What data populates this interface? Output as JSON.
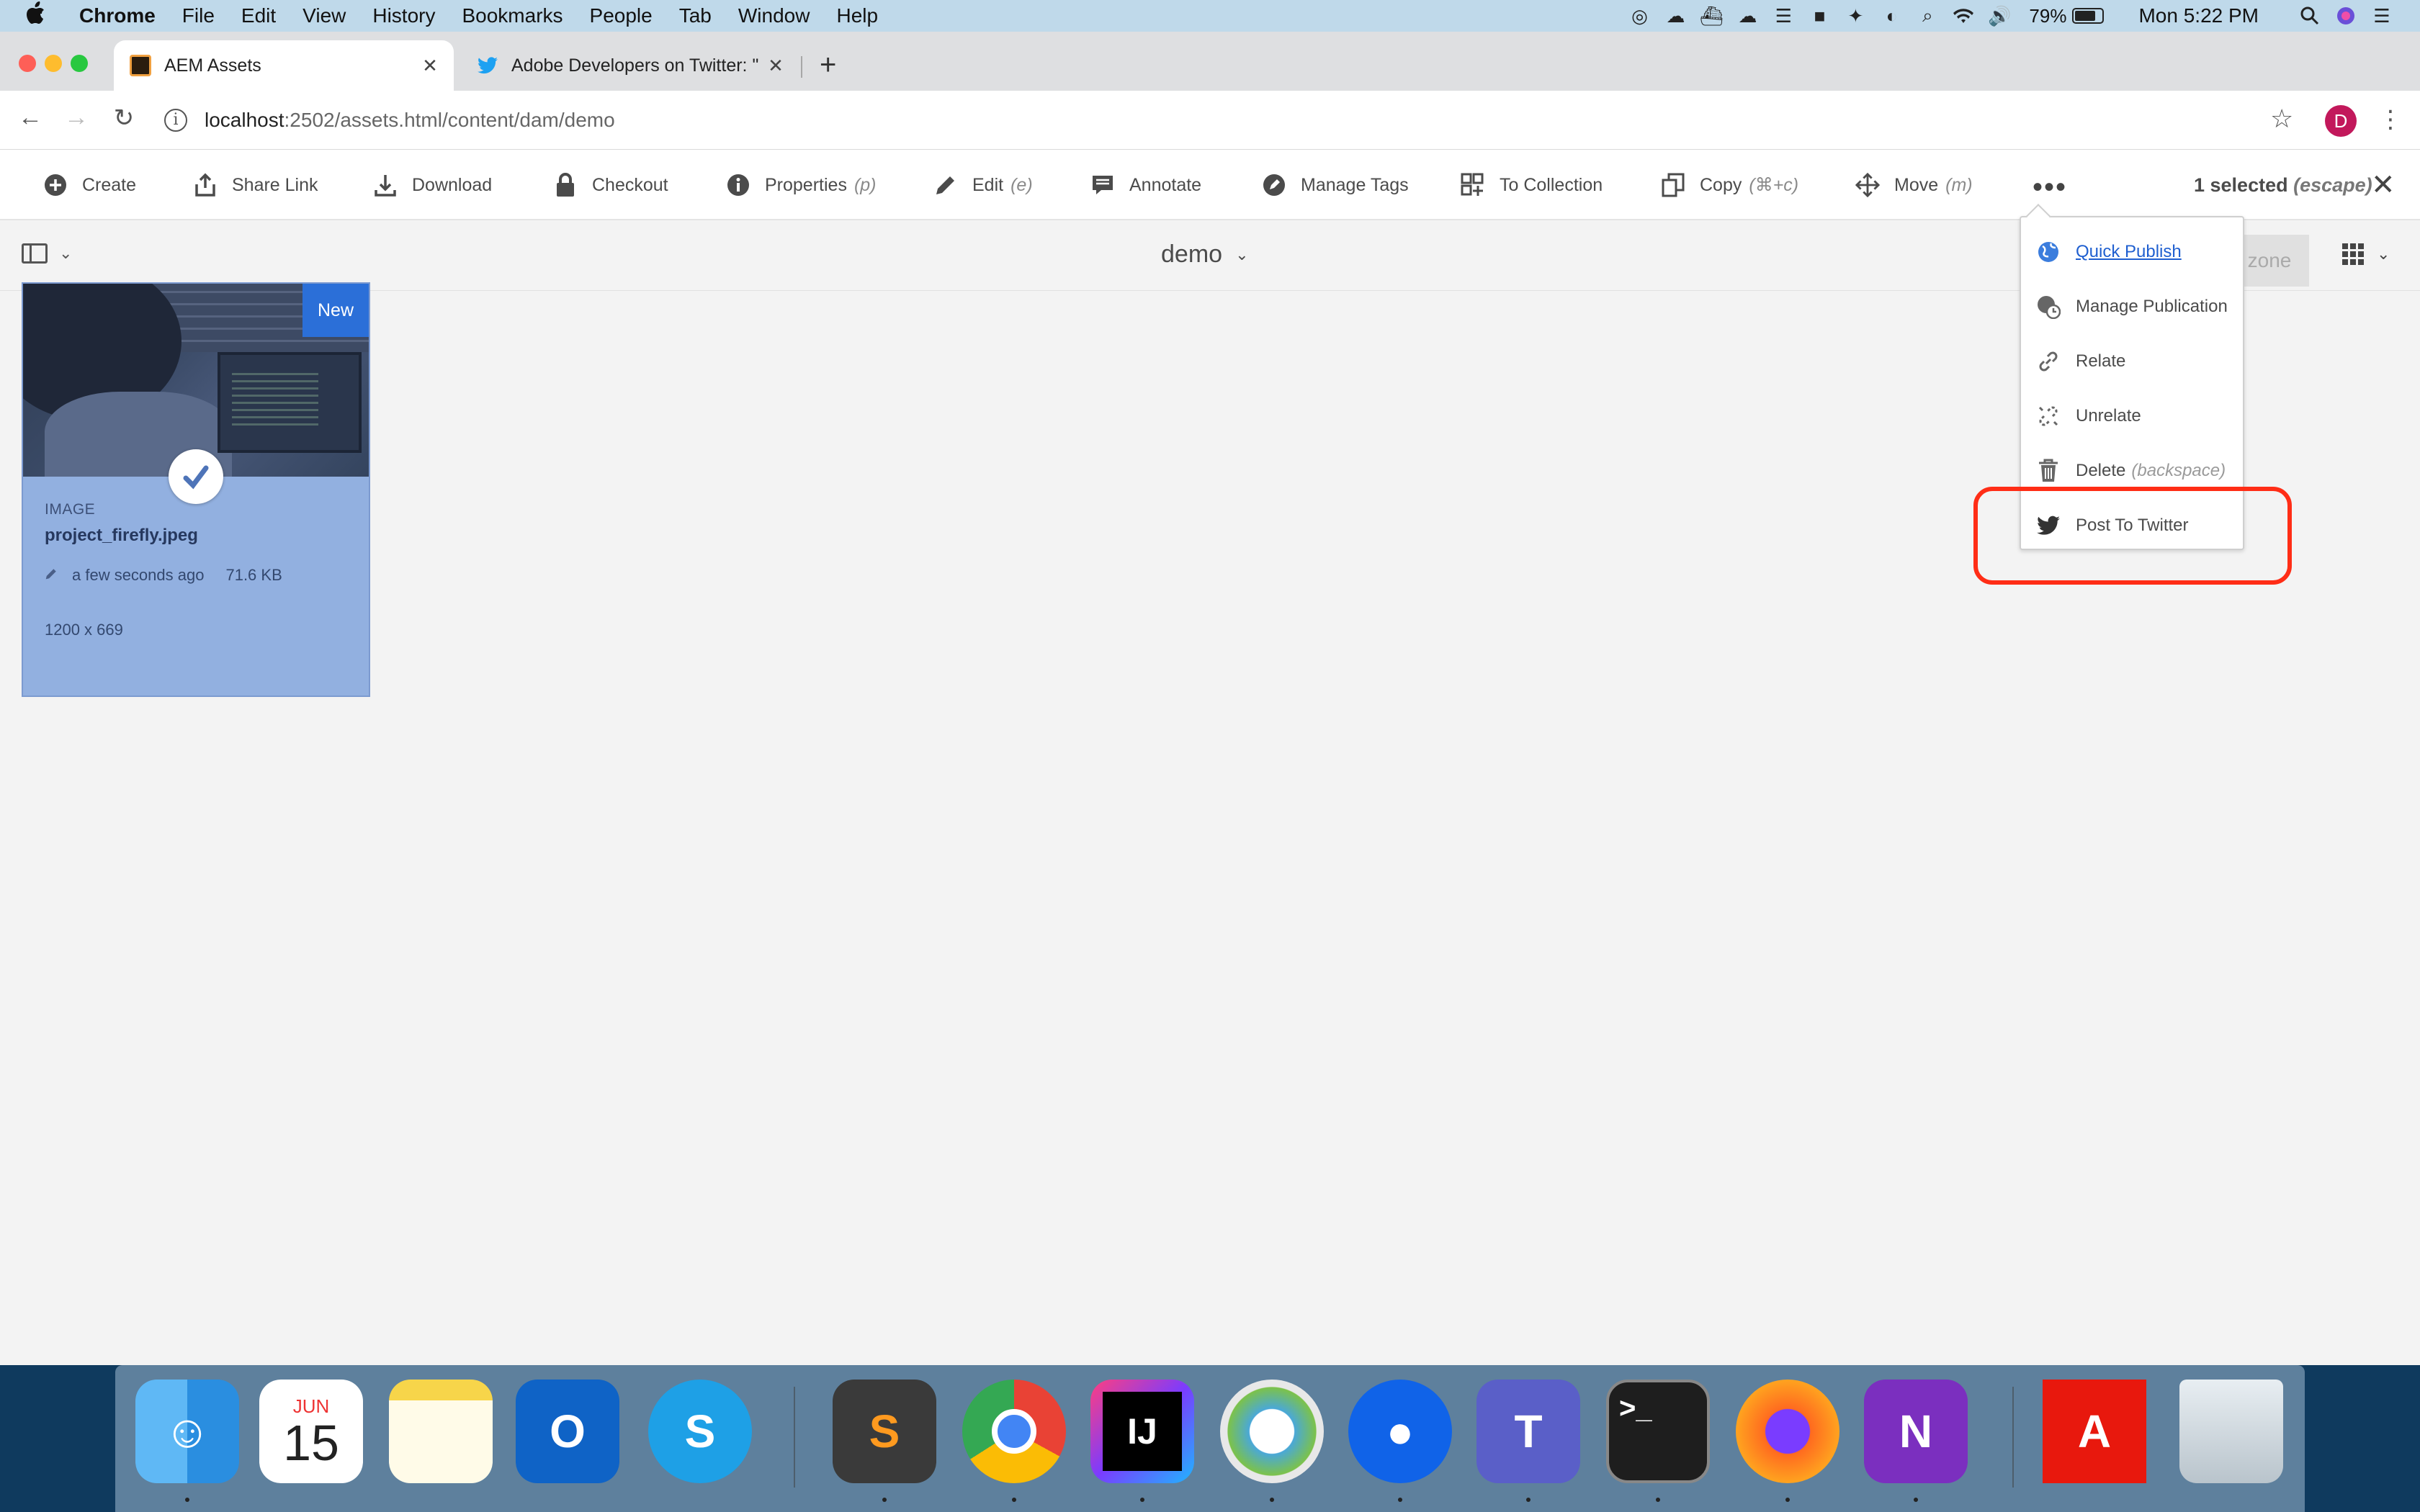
{
  "menubar": {
    "apple": "",
    "items": [
      "Chrome",
      "File",
      "Edit",
      "View",
      "History",
      "Bookmarks",
      "People",
      "Tab",
      "Window",
      "Help"
    ],
    "battery": "79%",
    "clock": "Mon 5:22 PM"
  },
  "browser": {
    "tabs": [
      {
        "label": "AEM Assets",
        "icon": "aem-icon",
        "active": true
      },
      {
        "label": "Adobe Developers on Twitter: \"",
        "icon": "twitter-icon",
        "active": false
      }
    ],
    "url_host": "localhost",
    "url_path": ":2502/assets.html/content/dam/demo",
    "profile_initial": "D"
  },
  "actionbar": {
    "actions": [
      {
        "label": "Create",
        "icon": "plus-circle-icon"
      },
      {
        "label": "Share Link",
        "icon": "share-icon"
      },
      {
        "label": "Download",
        "icon": "download-icon"
      },
      {
        "label": "Checkout",
        "icon": "lock-icon"
      },
      {
        "label": "Properties",
        "hint": "(p)",
        "icon": "info-icon"
      },
      {
        "label": "Edit",
        "hint": "(e)",
        "icon": "pencil-icon"
      },
      {
        "label": "Annotate",
        "icon": "comment-icon"
      },
      {
        "label": "Manage Tags",
        "icon": "tag-icon"
      },
      {
        "label": "To Collection",
        "icon": "collection-add-icon"
      },
      {
        "label": "Copy",
        "hint": "(⌘+c)",
        "icon": "copy-icon"
      },
      {
        "label": "Move",
        "hint": "(m)",
        "icon": "move-icon"
      }
    ],
    "more": "•••",
    "selected_count": "1 selected",
    "selected_hint": "(escape)"
  },
  "subbar": {
    "folder": "demo",
    "dropzone_partial": "zone"
  },
  "asset": {
    "badge": "New",
    "type": "IMAGE",
    "name": "project_firefly.jpeg",
    "modified": "a few seconds ago",
    "size": "71.6 KB",
    "dimensions": "1200 x 669"
  },
  "more_menu": {
    "items": [
      {
        "label": "Quick Publish",
        "icon": "globe-icon",
        "link": true
      },
      {
        "label": "Manage Publication",
        "icon": "globe-clock-icon"
      },
      {
        "label": "Relate",
        "icon": "link-icon"
      },
      {
        "label": "Unrelate",
        "icon": "unlink-icon"
      },
      {
        "label": "Delete",
        "hint": "(backspace)",
        "icon": "trash-icon"
      },
      {
        "label": "Post To Twitter",
        "icon": "twitter-icon"
      }
    ],
    "highlight_color": "#ff2d16"
  },
  "dock": {
    "apps": [
      "finder-icon",
      "calendar-icon",
      "notes-icon",
      "outlook-icon",
      "skype-icon",
      "sublime-icon",
      "chrome-icon",
      "intellij-icon",
      "anyconnect-icon",
      "proxyman-icon",
      "teams-icon",
      "terminal-icon",
      "firefox-icon",
      "onenote-icon",
      "adobe-icon",
      "trash-icon"
    ],
    "calendar_month": "JUN",
    "calendar_day": "15"
  }
}
